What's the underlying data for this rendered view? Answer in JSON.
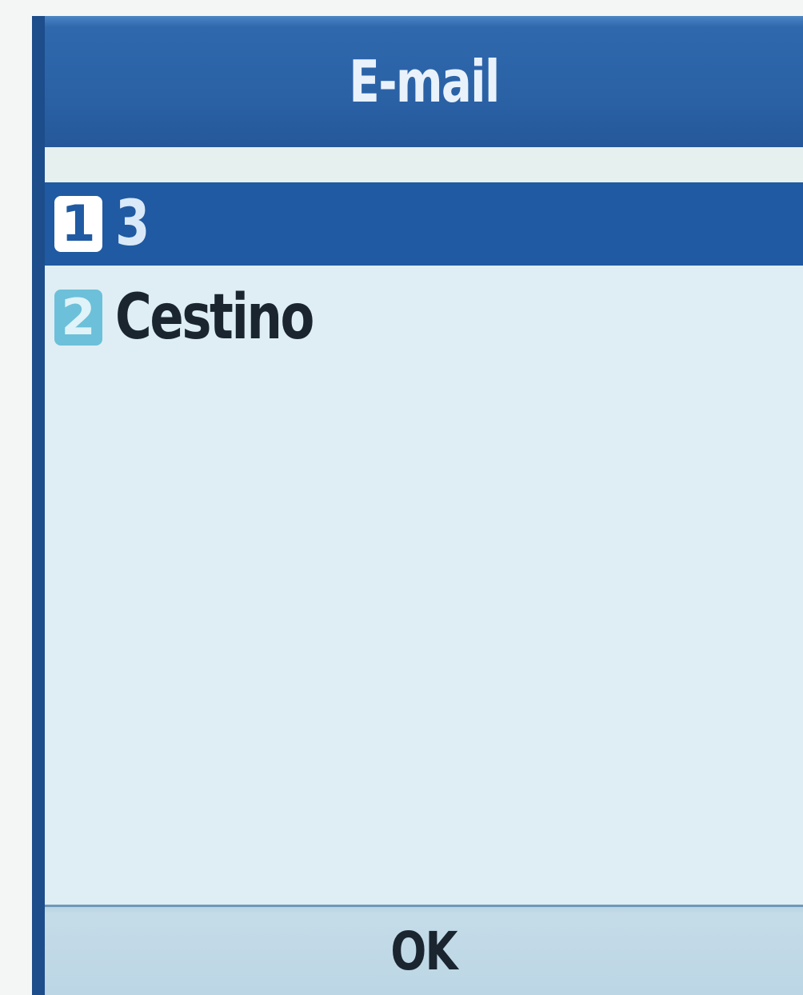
{
  "header": {
    "title": "E-mail"
  },
  "list": {
    "items": [
      {
        "number": "1",
        "label": "3",
        "selected": true
      },
      {
        "number": "2",
        "label": "Cestino",
        "selected": false
      }
    ]
  },
  "softkeys": {
    "center": "OK"
  },
  "colors": {
    "frame": "#1d4d8a",
    "title_bar": "#2b62a6",
    "selection": "#1f5aa2",
    "background": "#dfeef4",
    "softkey_bar": "#bcd6e5"
  }
}
